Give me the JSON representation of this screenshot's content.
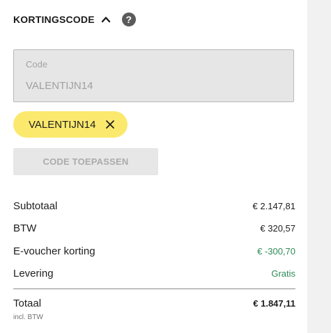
{
  "header": {
    "title": "KORTINGSCODE",
    "toggle_icon": "chevron-up-icon",
    "help_icon_glyph": "?"
  },
  "code_input": {
    "label": "Code",
    "value": "VALENTIJN14"
  },
  "applied_code": {
    "label": "VALENTIJN14",
    "remove_icon": "close-icon",
    "color": "#fbe96e"
  },
  "apply_button": {
    "label": "CODE TOEPASSEN"
  },
  "summary": {
    "rows": [
      {
        "label": "Subtotaal",
        "value": "€ 2.147,81"
      },
      {
        "label": "BTW",
        "value": "€ 320,57"
      },
      {
        "label": "E-voucher korting",
        "value": "€ -300,70"
      },
      {
        "label": "Levering",
        "value": "Gratis"
      }
    ],
    "accent_color": "#2e8b57"
  },
  "total": {
    "label": "Totaal",
    "sublabel": "incl. BTW",
    "value": "€ 1.847,11"
  }
}
